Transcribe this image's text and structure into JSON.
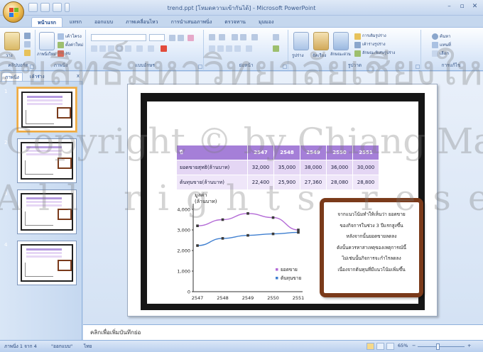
{
  "window": {
    "title": "trend.ppt [โหมดความเข้ากันได้] - Microsoft PowerPoint",
    "controls": [
      "–",
      "▫",
      "✕"
    ]
  },
  "ribbon": {
    "tabs": [
      {
        "label": "หน้าแรก",
        "active": true
      },
      {
        "label": "แทรก",
        "active": false
      },
      {
        "label": "ออกแบบ",
        "active": false
      },
      {
        "label": "ภาพเคลื่อนไหว",
        "active": false
      },
      {
        "label": "การนำเสนอภาพนิ่ง",
        "active": false
      },
      {
        "label": "ตรวจทาน",
        "active": false
      },
      {
        "label": "มุมมอง",
        "active": false
      }
    ],
    "groups": {
      "clipboard": "คลิปบอร์ด",
      "slides": "ภาพนิ่ง",
      "font": "แบบอักษร",
      "paragraph": "ย่อหน้า",
      "drawing": "รูปวาด",
      "editing": "การแก้ไข"
    },
    "buttons": {
      "paste": "วาง",
      "new_slide": "ภาพนิ่งใหม่",
      "layout": "เค้าโครง",
      "reset": "ตั้งค่าใหม่",
      "delete": "ลบ",
      "shapes": "รูปร่าง",
      "arrange": "จัดเรียง",
      "quick_styles": "ลักษณะด่วน",
      "shape_fill": "การเติมรูปร่าง",
      "shape_outline": "เค้าร่างรูปร่าง",
      "shape_effects": "ลักษณะพิเศษรูปร่าง",
      "find": "ค้นหา",
      "replace": "แทนที่",
      "select": "เลือก"
    }
  },
  "left_pane": {
    "tabs": [
      "ภาพนิ่ง",
      "เค้าร่าง"
    ],
    "close": "x",
    "thumbs": [
      {
        "number": "1",
        "selected": true
      },
      {
        "number": "2",
        "selected": false
      },
      {
        "number": "3",
        "selected": false
      },
      {
        "number": "4",
        "selected": false
      }
    ]
  },
  "slide": {
    "table": {
      "header": [
        "ปี",
        "2547",
        "2548",
        "2549",
        "2550",
        "2551"
      ],
      "rows": [
        [
          "ยอดขายสุทธิ(ล้านบาท)",
          "32,000",
          "35,000",
          "38,000",
          "36,000",
          "30,000"
        ],
        [
          "ต้นทุนขาย(ล้านบาท)",
          "22,400",
          "25,900",
          "27,360",
          "28,080",
          "28,800"
        ]
      ]
    },
    "note": [
      "จากแนวโน้มทำให้เห็นว่า ยอดขาย",
      "ของกิจการในช่วง 3 ปีแรกสูงขึ้น",
      "หลังจากนั้นยอดขายลดลง",
      "ดังนั้นควรหาสาเหตุของเหตุการณ์นี้",
      "ไม่เช่นนั้นกิจการจะกำไรลดลง",
      "เนื่องจากต้นทุนที่มีแนวโน้มเพิ่มขึ้น"
    ]
  },
  "chart_data": {
    "type": "line",
    "title": "",
    "ylabel": "มูลค่า (ล้านบาท)",
    "ylabel_lines": [
      "มูลค่า",
      "(ล้านบาท)"
    ],
    "xlabel": "",
    "x": [
      "2547",
      "2548",
      "2549",
      "2550",
      "2551"
    ],
    "yticks": [
      "0",
      "1,000",
      "2,000",
      "3,000",
      "4,000"
    ],
    "ylim": [
      0,
      4000
    ],
    "series": [
      {
        "name": "ยอดขาย",
        "values": [
          3200,
          3500,
          3800,
          3600,
          3000
        ],
        "color": "#b36ad6"
      },
      {
        "name": "ต้นทุนขาย",
        "values": [
          2240,
          2590,
          2736,
          2808,
          2880
        ],
        "color": "#3f7fd0"
      }
    ],
    "legend_position": "bottom-right"
  },
  "notes_pane": {
    "placeholder": "คลิกเพื่อเพิ่มบันทึกย่อ"
  },
  "status": {
    "slide_info": "ภาพนิ่ง 1 จาก 4",
    "theme": "\"ออกแบบ\"",
    "language": "ไทย",
    "zoom": "65%"
  },
  "watermark": {
    "line1": "ลิขสิทธิ์มหาวิทยาลัยเชียงใหม่",
    "line2": "Copyright © by Chiang Mai University",
    "line3": "All rights reserved"
  },
  "colors": {
    "accent": "#15428b",
    "table_header": "#a57fd8",
    "note_border": "#7a3a1a"
  }
}
